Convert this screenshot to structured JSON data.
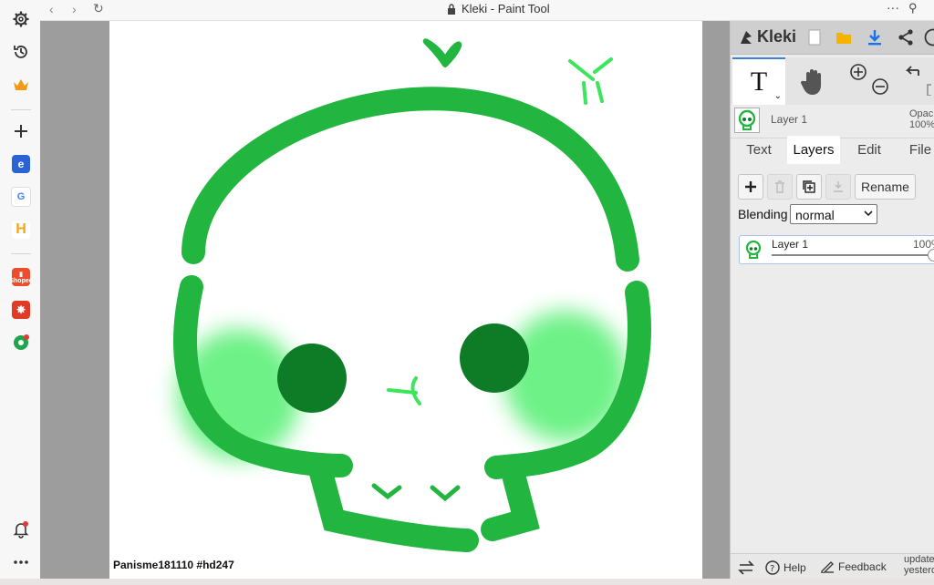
{
  "browser": {
    "title": "Kleki - Paint Tool",
    "nav": [
      "back",
      "forward",
      "reload"
    ],
    "menu_icon": "more-horizontal-icon",
    "pin_icon": "pin-icon"
  },
  "sidebar": {
    "items": [
      {
        "name": "settings",
        "icon": "gear-icon"
      },
      {
        "name": "history",
        "icon": "history-icon"
      },
      {
        "name": "crown",
        "icon": "crown-icon"
      },
      {
        "name": "add",
        "icon": "plus-icon"
      },
      {
        "name": "app-1",
        "icon": "app-blue-icon"
      },
      {
        "name": "google",
        "icon": "google-icon"
      },
      {
        "name": "app-h",
        "icon": "h-app-icon"
      },
      {
        "name": "shopee",
        "icon": "shopee-icon",
        "label": "Shopee"
      },
      {
        "name": "app-red",
        "icon": "red-app-icon"
      },
      {
        "name": "app-ball",
        "icon": "ball-app-icon"
      },
      {
        "name": "notifications",
        "icon": "bell-icon"
      },
      {
        "name": "more",
        "icon": "more-icon"
      }
    ]
  },
  "canvas": {
    "watermark": "Panisme181110 #hd247",
    "stroke_color": "#22b640",
    "eye_color": "#0e7b27",
    "blush_color": "#5ff07a",
    "accent_color": "#3ae65a"
  },
  "panel": {
    "logo": "Kleki",
    "tool_text_label": "T",
    "current_layer": "Layer 1",
    "opacity_label": "Opac",
    "opacity_value": "100%",
    "tabs": [
      {
        "label": "Text",
        "active": false
      },
      {
        "label": "Layers",
        "active": true
      },
      {
        "label": "Edit",
        "active": false
      },
      {
        "label": "File",
        "active": false
      }
    ],
    "actions": {
      "rename": "Rename"
    },
    "blending_label": "Blending",
    "blending_value": "normal",
    "layer_card": {
      "name": "Layer 1",
      "opacity": "100%",
      "opacity_fraction": 1.0
    },
    "footer": {
      "help": "Help",
      "feedback": "Feedback",
      "updated": "update",
      "updated_when": "yesterd"
    }
  }
}
